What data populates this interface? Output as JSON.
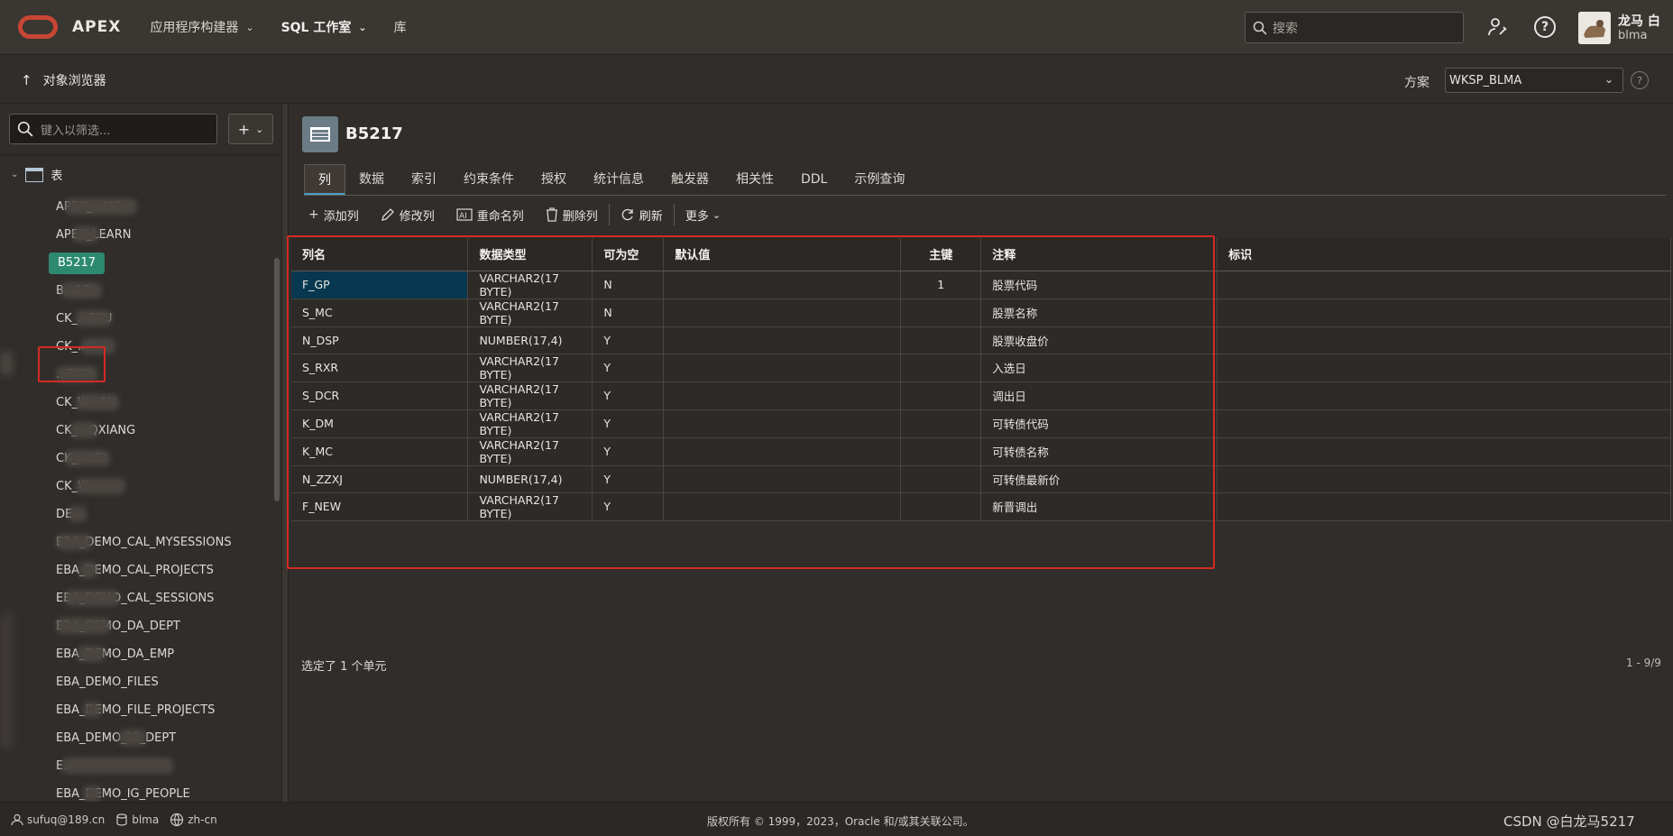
{
  "topbar": {
    "logo_text": "APEX",
    "nav": [
      {
        "label": "应用程序构建器",
        "chevron": true,
        "bold": false
      },
      {
        "label": "SQL 工作室",
        "chevron": true,
        "bold": true
      },
      {
        "label": "库",
        "chevron": false,
        "bold": false
      }
    ],
    "search_placeholder": "搜索",
    "user_name": "龙马 白",
    "user_login": "blma"
  },
  "subbar": {
    "back_label": "对象浏览器",
    "schema_label": "方案",
    "schema_value": "WKSP_BLMA",
    "help_glyph": "?"
  },
  "leftpane": {
    "filter_placeholder": "键入以筛选...",
    "add_label": "+",
    "tree_root": "表",
    "items": [
      {
        "label": "APEX_...NG",
        "smudge": [
          10,
          80
        ]
      },
      {
        "label": "APEX_LEARN",
        "smudge": [
          18,
          30
        ]
      },
      {
        "label": "B5217",
        "selected": true
      },
      {
        "label": "B...17",
        "smudge": [
          6,
          45
        ]
      },
      {
        "label": "CK_...SKU",
        "smudge": [
          22,
          40
        ]
      },
      {
        "label": "CK_...K",
        "smudge": [
          28,
          38
        ]
      },
      {
        "label": "...RUK",
        "smudge": [
          0,
          46
        ]
      },
      {
        "label": "CK_W...AN",
        "smudge": [
          22,
          48
        ]
      },
      {
        "label": "CK_...QXIANG",
        "smudge": [
          16,
          30
        ]
      },
      {
        "label": "CK_...LEI",
        "smudge": [
          10,
          50
        ]
      },
      {
        "label": "CK_W...",
        "smudge": [
          22,
          55
        ]
      },
      {
        "label": "DE...",
        "smudge": [
          14,
          20
        ]
      },
      {
        "label": "EBA_DEMO_CAL_MYSESSIONS",
        "smudge": [
          0,
          40
        ]
      },
      {
        "label": "EBA_DEMO_CAL_PROJECTS",
        "smudge": [
          26,
          20
        ]
      },
      {
        "label": "EBA_DEMO_CAL_SESSIONS",
        "smudge": [
          10,
          60
        ]
      },
      {
        "label": "EBA_DEMO_DA_DEPT",
        "smudge": [
          0,
          60
        ]
      },
      {
        "label": "EBA_DEMO_DA_EMP",
        "smudge": [
          24,
          30
        ]
      },
      {
        "label": "EBA_DEMO_FILES",
        "smudge": []
      },
      {
        "label": "EBA_DEMO_FILE_PROJECTS",
        "smudge": [
          30,
          20
        ]
      },
      {
        "label": "EBA_DEMO_IG_DEPT",
        "smudge": [
          70,
          30
        ]
      },
      {
        "label": "E...",
        "smudge": [
          6,
          124
        ]
      },
      {
        "label": "EBA_DEMO_IG_PEOPLE",
        "smudge": [
          30,
          20
        ]
      }
    ]
  },
  "main": {
    "object_title": "B5217",
    "tabs": [
      "列",
      "数据",
      "索引",
      "约束条件",
      "授权",
      "统计信息",
      "触发器",
      "相关性",
      "DDL",
      "示例查询"
    ],
    "toolbar": {
      "add_column": "添加列",
      "modify_column": "修改列",
      "rename_column": "重命名列",
      "delete_column": "删除列",
      "refresh": "刷新",
      "more": "更多"
    },
    "columns": [
      "列名",
      "数据类型",
      "可为空",
      "默认值",
      "主键",
      "注释",
      "标识"
    ],
    "rows": [
      [
        "F_GP",
        "VARCHAR2(17 BYTE)",
        "N",
        "",
        "1",
        "股票代码",
        ""
      ],
      [
        "S_MC",
        "VARCHAR2(17 BYTE)",
        "N",
        "",
        "",
        "股票名称",
        ""
      ],
      [
        "N_DSP",
        "NUMBER(17,4)",
        "Y",
        "",
        "",
        "股票收盘价",
        ""
      ],
      [
        "S_RXR",
        "VARCHAR2(17 BYTE)",
        "Y",
        "",
        "",
        "入选日",
        ""
      ],
      [
        "S_DCR",
        "VARCHAR2(17 BYTE)",
        "Y",
        "",
        "",
        "调出日",
        ""
      ],
      [
        "K_DM",
        "VARCHAR2(17 BYTE)",
        "Y",
        "",
        "",
        "可转债代码",
        ""
      ],
      [
        "K_MC",
        "VARCHAR2(17 BYTE)",
        "Y",
        "",
        "",
        "可转债名称",
        ""
      ],
      [
        "N_ZZXJ",
        "NUMBER(17,4)",
        "Y",
        "",
        "",
        "可转债最新价",
        ""
      ],
      [
        "F_NEW",
        "VARCHAR2(17 BYTE)",
        "Y",
        "",
        "",
        "新晋调出",
        ""
      ]
    ],
    "selection_info": "选定了 1 个单元",
    "pagination": "1 - 9/9"
  },
  "statusbar": {
    "user_email": "sufuq@189.cn",
    "schema": "blma",
    "language": "zh-cn",
    "copyright": "版权所有 © 1999，2023，Oracle 和/或其关联公司。",
    "watermark": "CSDN @白龙马5217"
  },
  "colors": {
    "accent_blue": "#4a9ec2",
    "selected_green": "#2d8a6f",
    "highlight_red": "#d32a24",
    "brand_red": "#c74634"
  }
}
